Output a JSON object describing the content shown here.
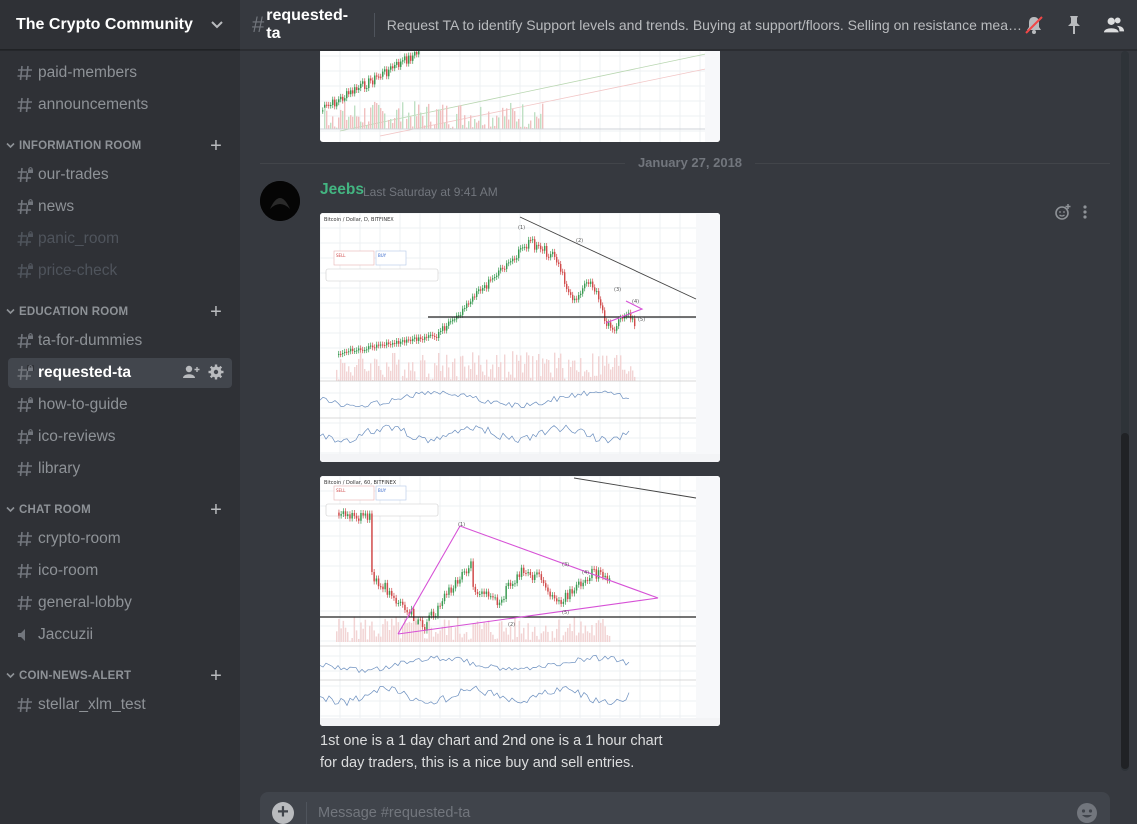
{
  "guild": {
    "name": "The Crypto Community"
  },
  "channels_top": [
    {
      "name": "paid-members",
      "muted": false,
      "icon": "hash"
    },
    {
      "name": "announcements",
      "muted": false,
      "icon": "hash"
    }
  ],
  "categories": [
    {
      "name": "INFORMATION ROOM",
      "channels": [
        {
          "name": "our-trades",
          "muted": false,
          "icon": "hash-lock"
        },
        {
          "name": "news",
          "muted": false,
          "icon": "hash-lock"
        },
        {
          "name": "panic_room",
          "muted": true,
          "icon": "hash-lock"
        },
        {
          "name": "price-check",
          "muted": true,
          "icon": "hash-lock"
        }
      ]
    },
    {
      "name": "EDUCATION ROOM",
      "channels": [
        {
          "name": "ta-for-dummies",
          "muted": false,
          "icon": "hash-lock"
        },
        {
          "name": "requested-ta",
          "muted": false,
          "icon": "hash-lock",
          "selected": true
        },
        {
          "name": "how-to-guide",
          "muted": false,
          "icon": "hash-lock"
        },
        {
          "name": "ico-reviews",
          "muted": false,
          "icon": "hash-lock"
        },
        {
          "name": "library",
          "muted": false,
          "icon": "hash"
        }
      ]
    },
    {
      "name": "CHAT ROOM",
      "channels": [
        {
          "name": "crypto-room",
          "muted": false,
          "icon": "hash"
        },
        {
          "name": "ico-room",
          "muted": false,
          "icon": "hash"
        },
        {
          "name": "general-lobby",
          "muted": false,
          "icon": "hash"
        },
        {
          "name": "Jaccuzii",
          "muted": false,
          "icon": "voice"
        }
      ]
    },
    {
      "name": "COIN-NEWS-ALERT",
      "channels": [
        {
          "name": "stellar_xlm_test",
          "muted": false,
          "icon": "hash"
        }
      ]
    }
  ],
  "header": {
    "channel_name": "requested-ta",
    "topic": "Request TA to identify Support levels and trends. Buying at support/floors. Selling on resistance means yo..."
  },
  "date_divider": "January 27, 2018",
  "message": {
    "author": "Jeebs",
    "timestamp": "Last Saturday at 9:41 AM",
    "lines": [
      "1st one is a 1 day chart and 2nd one is a 1 hour chart",
      "for day traders, this is a nice buy and sell entries."
    ],
    "chart1": {
      "pair_label": "Bitcoin / Dollar, D, BITFINEX",
      "sell_label": "SELL",
      "buy_label": "BUY",
      "wave_labels": [
        "(1)",
        "(2)",
        "(3)",
        "(4)",
        "(5)"
      ]
    },
    "chart2": {
      "pair_label": "Bitcoin / Dollar, 60, BITFINEX",
      "sell_label": "SELL",
      "buy_label": "BUY",
      "wave_labels": [
        "(1)",
        "(2)",
        "(3)",
        "(4)",
        "(5)"
      ]
    }
  },
  "composer": {
    "placeholder": "Message #requested-ta"
  },
  "colors": {
    "accent_author": "#43b581",
    "sidebar_bg": "#2f3136",
    "chat_bg": "#36393f",
    "candle_up": "#3a9a52",
    "candle_down": "#d14b4b",
    "triangle": "#d651d6"
  }
}
